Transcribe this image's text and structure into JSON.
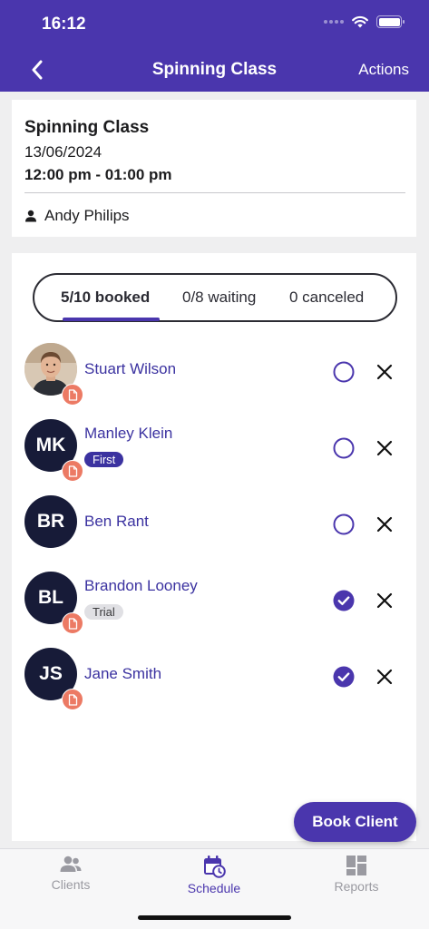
{
  "status_bar": {
    "time": "16:12"
  },
  "nav": {
    "back_icon": "chevron-left-icon",
    "title": "Spinning Class",
    "action": "Actions"
  },
  "class": {
    "name": "Spinning Class",
    "date": "13/06/2024",
    "time": "12:00 pm - 01:00 pm",
    "instructor": "Andy Philips"
  },
  "tabs": {
    "booked": "5/10 booked",
    "waiting": "0/8 waiting",
    "canceled": "0 canceled",
    "active": "booked"
  },
  "clients": [
    {
      "name": "Stuart Wilson",
      "initials": "",
      "photo": true,
      "has_document": true,
      "tag": "",
      "checked_in": false
    },
    {
      "name": "Manley Klein",
      "initials": "MK",
      "photo": false,
      "has_document": true,
      "tag": "First",
      "checked_in": false
    },
    {
      "name": "Ben Rant",
      "initials": "BR",
      "photo": false,
      "has_document": false,
      "tag": "",
      "checked_in": false
    },
    {
      "name": "Brandon Looney",
      "initials": "BL",
      "photo": false,
      "has_document": true,
      "tag": "Trial",
      "checked_in": true
    },
    {
      "name": "Jane Smith",
      "initials": "JS",
      "photo": false,
      "has_document": true,
      "tag": "",
      "checked_in": true
    }
  ],
  "fab": {
    "label": "Book Client"
  },
  "bottom_tabs": [
    {
      "label": "Clients",
      "icon": "people-icon",
      "active": false
    },
    {
      "label": "Schedule",
      "icon": "calendar-clock-icon",
      "active": true
    },
    {
      "label": "Reports",
      "icon": "dashboard-grid-icon",
      "active": false
    }
  ],
  "colors": {
    "brand": "#4a36ad",
    "name_link": "#3b32a0",
    "document_badge": "#ec7a64",
    "avatar_bg": "#171b38"
  }
}
